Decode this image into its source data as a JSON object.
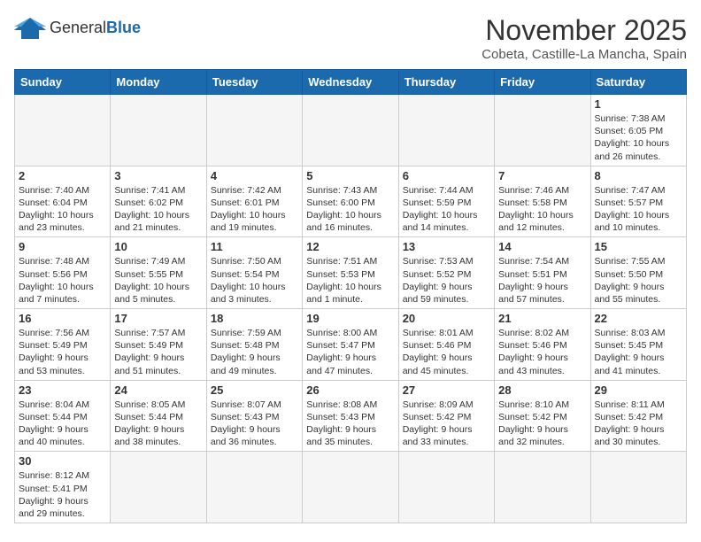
{
  "header": {
    "logo_general": "General",
    "logo_blue": "Blue",
    "month": "November 2025",
    "location": "Cobeta, Castille-La Mancha, Spain"
  },
  "days_of_week": [
    "Sunday",
    "Monday",
    "Tuesday",
    "Wednesday",
    "Thursday",
    "Friday",
    "Saturday"
  ],
  "weeks": [
    [
      {
        "day": "",
        "info": ""
      },
      {
        "day": "",
        "info": ""
      },
      {
        "day": "",
        "info": ""
      },
      {
        "day": "",
        "info": ""
      },
      {
        "day": "",
        "info": ""
      },
      {
        "day": "",
        "info": ""
      },
      {
        "day": "1",
        "info": "Sunrise: 7:38 AM\nSunset: 6:05 PM\nDaylight: 10 hours\nand 26 minutes."
      }
    ],
    [
      {
        "day": "2",
        "info": "Sunrise: 7:40 AM\nSunset: 6:04 PM\nDaylight: 10 hours\nand 23 minutes."
      },
      {
        "day": "3",
        "info": "Sunrise: 7:41 AM\nSunset: 6:02 PM\nDaylight: 10 hours\nand 21 minutes."
      },
      {
        "day": "4",
        "info": "Sunrise: 7:42 AM\nSunset: 6:01 PM\nDaylight: 10 hours\nand 19 minutes."
      },
      {
        "day": "5",
        "info": "Sunrise: 7:43 AM\nSunset: 6:00 PM\nDaylight: 10 hours\nand 16 minutes."
      },
      {
        "day": "6",
        "info": "Sunrise: 7:44 AM\nSunset: 5:59 PM\nDaylight: 10 hours\nand 14 minutes."
      },
      {
        "day": "7",
        "info": "Sunrise: 7:46 AM\nSunset: 5:58 PM\nDaylight: 10 hours\nand 12 minutes."
      },
      {
        "day": "8",
        "info": "Sunrise: 7:47 AM\nSunset: 5:57 PM\nDaylight: 10 hours\nand 10 minutes."
      }
    ],
    [
      {
        "day": "9",
        "info": "Sunrise: 7:48 AM\nSunset: 5:56 PM\nDaylight: 10 hours\nand 7 minutes."
      },
      {
        "day": "10",
        "info": "Sunrise: 7:49 AM\nSunset: 5:55 PM\nDaylight: 10 hours\nand 5 minutes."
      },
      {
        "day": "11",
        "info": "Sunrise: 7:50 AM\nSunset: 5:54 PM\nDaylight: 10 hours\nand 3 minutes."
      },
      {
        "day": "12",
        "info": "Sunrise: 7:51 AM\nSunset: 5:53 PM\nDaylight: 10 hours\nand 1 minute."
      },
      {
        "day": "13",
        "info": "Sunrise: 7:53 AM\nSunset: 5:52 PM\nDaylight: 9 hours\nand 59 minutes."
      },
      {
        "day": "14",
        "info": "Sunrise: 7:54 AM\nSunset: 5:51 PM\nDaylight: 9 hours\nand 57 minutes."
      },
      {
        "day": "15",
        "info": "Sunrise: 7:55 AM\nSunset: 5:50 PM\nDaylight: 9 hours\nand 55 minutes."
      }
    ],
    [
      {
        "day": "16",
        "info": "Sunrise: 7:56 AM\nSunset: 5:49 PM\nDaylight: 9 hours\nand 53 minutes."
      },
      {
        "day": "17",
        "info": "Sunrise: 7:57 AM\nSunset: 5:49 PM\nDaylight: 9 hours\nand 51 minutes."
      },
      {
        "day": "18",
        "info": "Sunrise: 7:59 AM\nSunset: 5:48 PM\nDaylight: 9 hours\nand 49 minutes."
      },
      {
        "day": "19",
        "info": "Sunrise: 8:00 AM\nSunset: 5:47 PM\nDaylight: 9 hours\nand 47 minutes."
      },
      {
        "day": "20",
        "info": "Sunrise: 8:01 AM\nSunset: 5:46 PM\nDaylight: 9 hours\nand 45 minutes."
      },
      {
        "day": "21",
        "info": "Sunrise: 8:02 AM\nSunset: 5:46 PM\nDaylight: 9 hours\nand 43 minutes."
      },
      {
        "day": "22",
        "info": "Sunrise: 8:03 AM\nSunset: 5:45 PM\nDaylight: 9 hours\nand 41 minutes."
      }
    ],
    [
      {
        "day": "23",
        "info": "Sunrise: 8:04 AM\nSunset: 5:44 PM\nDaylight: 9 hours\nand 40 minutes."
      },
      {
        "day": "24",
        "info": "Sunrise: 8:05 AM\nSunset: 5:44 PM\nDaylight: 9 hours\nand 38 minutes."
      },
      {
        "day": "25",
        "info": "Sunrise: 8:07 AM\nSunset: 5:43 PM\nDaylight: 9 hours\nand 36 minutes."
      },
      {
        "day": "26",
        "info": "Sunrise: 8:08 AM\nSunset: 5:43 PM\nDaylight: 9 hours\nand 35 minutes."
      },
      {
        "day": "27",
        "info": "Sunrise: 8:09 AM\nSunset: 5:42 PM\nDaylight: 9 hours\nand 33 minutes."
      },
      {
        "day": "28",
        "info": "Sunrise: 8:10 AM\nSunset: 5:42 PM\nDaylight: 9 hours\nand 32 minutes."
      },
      {
        "day": "29",
        "info": "Sunrise: 8:11 AM\nSunset: 5:42 PM\nDaylight: 9 hours\nand 30 minutes."
      }
    ],
    [
      {
        "day": "30",
        "info": "Sunrise: 8:12 AM\nSunset: 5:41 PM\nDaylight: 9 hours\nand 29 minutes."
      },
      {
        "day": "",
        "info": ""
      },
      {
        "day": "",
        "info": ""
      },
      {
        "day": "",
        "info": ""
      },
      {
        "day": "",
        "info": ""
      },
      {
        "day": "",
        "info": ""
      },
      {
        "day": "",
        "info": ""
      }
    ]
  ]
}
